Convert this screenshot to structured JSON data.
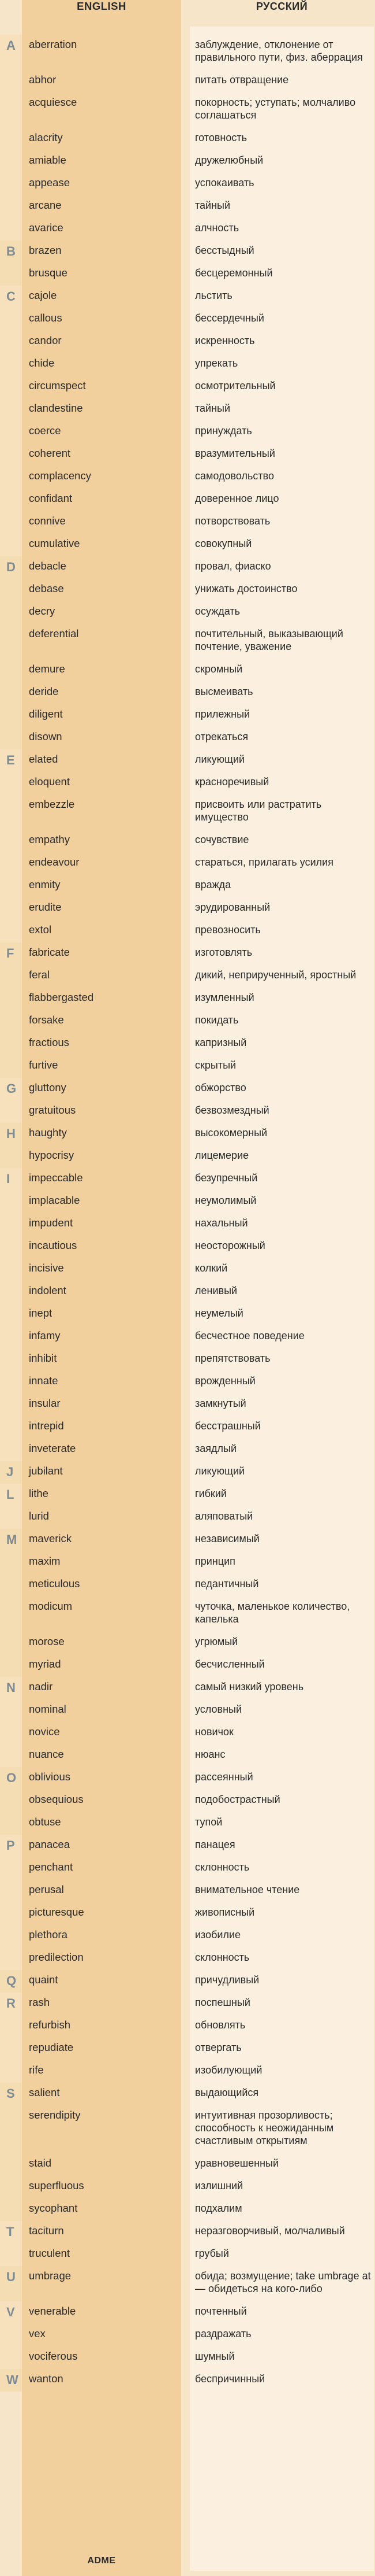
{
  "headers": {
    "english": "ENGLISH",
    "russian": "РУССКИЙ"
  },
  "footer": "ADME",
  "groups": [
    {
      "letter": "A",
      "words": [
        [
          "aberration",
          "заблуждение, отклонение от правильного пути, физ. аберрация"
        ],
        [
          "abhor",
          "питать отвращение"
        ],
        [
          "acquiesce",
          "покорность; уступать; молчаливо соглашаться"
        ],
        [
          "alacrity",
          "готовность"
        ],
        [
          "amiable",
          "дружелюбный"
        ],
        [
          "appease",
          "успокаивать"
        ],
        [
          "arcane",
          "тайный"
        ],
        [
          "avarice",
          "алчность"
        ]
      ]
    },
    {
      "letter": "B",
      "words": [
        [
          "brazen",
          "бесстыдный"
        ],
        [
          "brusque",
          "бесцеремонный"
        ]
      ]
    },
    {
      "letter": "C",
      "words": [
        [
          "cajole",
          "льстить"
        ],
        [
          "callous",
          "бессердечный"
        ],
        [
          "candor",
          "искренность"
        ],
        [
          "chide",
          "упрекать"
        ],
        [
          "circumspect",
          "осмотрительный"
        ],
        [
          "clandestine",
          "тайный"
        ],
        [
          "coerce",
          "принуждать"
        ],
        [
          "coherent",
          "вразумительный"
        ],
        [
          "complacency",
          "самодовольство"
        ],
        [
          "confidant",
          "доверенное лицо"
        ],
        [
          "connive",
          "потворствовать"
        ],
        [
          "cumulative",
          "совокупный"
        ]
      ]
    },
    {
      "letter": "D",
      "words": [
        [
          "debacle",
          "провал, фиаско"
        ],
        [
          "debase",
          "унижать достоинство"
        ],
        [
          "decry",
          "осуждать"
        ],
        [
          "deferential",
          "почтительный, выказывающий почтение, уважение"
        ],
        [
          "demure",
          "скромный"
        ],
        [
          "deride",
          "высмеивать"
        ],
        [
          "diligent",
          "прилежный"
        ],
        [
          "disown",
          "отрекаться"
        ]
      ]
    },
    {
      "letter": "E",
      "words": [
        [
          "elated",
          "ликующий"
        ],
        [
          "eloquent",
          "красноречивый"
        ],
        [
          "embezzle",
          "присвоить или растратить имущество"
        ],
        [
          "empathy",
          "сочувствие"
        ],
        [
          "endeavour",
          "стараться, прилагать усилия"
        ],
        [
          "enmity",
          "вражда"
        ],
        [
          "erudite",
          "эрудированный"
        ],
        [
          "extol",
          "превозносить"
        ]
      ]
    },
    {
      "letter": "F",
      "words": [
        [
          "fabricate",
          "изготовлять"
        ],
        [
          "feral",
          "дикий, неприрученный, яростный"
        ],
        [
          "flabbergasted",
          "изумленный"
        ],
        [
          "forsake",
          "покидать"
        ],
        [
          "fractious",
          "капризный"
        ],
        [
          "furtive",
          "скрытый"
        ]
      ]
    },
    {
      "letter": "G",
      "words": [
        [
          "gluttony",
          "обжорство"
        ],
        [
          "gratuitous",
          "безвозмездный"
        ]
      ]
    },
    {
      "letter": "H",
      "words": [
        [
          "haughty",
          "высокомерный"
        ],
        [
          "hypocrisy",
          "лицемерие"
        ]
      ]
    },
    {
      "letter": "I",
      "words": [
        [
          "impeccable",
          "безупречный"
        ],
        [
          "implacable",
          "неумолимый"
        ],
        [
          "impudent",
          "нахальный"
        ],
        [
          "incautious",
          "неосторожный"
        ],
        [
          "incisive",
          "колкий"
        ],
        [
          "indolent",
          "ленивый"
        ],
        [
          "inept",
          "неумелый"
        ],
        [
          "infamy",
          "бесчестное поведение"
        ],
        [
          "inhibit",
          "препятствовать"
        ],
        [
          "innate",
          "врожденный"
        ],
        [
          "insular",
          "замкнутый"
        ],
        [
          "intrepid",
          "бесстрашный"
        ],
        [
          "inveterate",
          "заядлый"
        ]
      ]
    },
    {
      "letter": "J",
      "words": [
        [
          "jubilant",
          "ликующий"
        ]
      ]
    },
    {
      "letter": "L",
      "words": [
        [
          "lithe",
          "гибкий"
        ],
        [
          "lurid",
          "аляповатый"
        ]
      ]
    },
    {
      "letter": "M",
      "words": [
        [
          "maverick",
          "независимый"
        ],
        [
          "maxim",
          "принцип"
        ],
        [
          "meticulous",
          "педантичный"
        ],
        [
          "modicum",
          "чуточка, маленькое количество, капелька"
        ],
        [
          "morose",
          "угрюмый"
        ],
        [
          "myriad",
          "бесчисленный"
        ]
      ]
    },
    {
      "letter": "N",
      "words": [
        [
          "nadir",
          "самый низкий уровень"
        ],
        [
          "nominal",
          "условный"
        ],
        [
          "novice",
          "новичок"
        ],
        [
          "nuance",
          "нюанс"
        ]
      ]
    },
    {
      "letter": "O",
      "words": [
        [
          "oblivious",
          "рассеянный"
        ],
        [
          "obsequious",
          "подобострастный"
        ],
        [
          "obtuse",
          "тупой"
        ]
      ]
    },
    {
      "letter": "P",
      "words": [
        [
          "panacea",
          "панацея"
        ],
        [
          "penchant",
          "склонность"
        ],
        [
          "perusal",
          "внимательное чтение"
        ],
        [
          "picturesque",
          "живописный"
        ],
        [
          "plethora",
          "изобилие"
        ],
        [
          "predilection",
          "склонность"
        ]
      ]
    },
    {
      "letter": "Q",
      "words": [
        [
          "quaint",
          "причудливый"
        ]
      ]
    },
    {
      "letter": "R",
      "words": [
        [
          "rash",
          "поспешный"
        ],
        [
          "refurbish",
          "обновлять"
        ],
        [
          "repudiate",
          "отвергать"
        ],
        [
          "rife",
          "изобилующий"
        ]
      ]
    },
    {
      "letter": "S",
      "words": [
        [
          "salient",
          "выдающийся"
        ],
        [
          "serendipity",
          "интуитивная прозорливость; способность к неожиданным счастливым открытиям"
        ],
        [
          "staid",
          "уравновешенный"
        ],
        [
          "superfluous",
          "излишний"
        ],
        [
          "sycophant",
          "подхалим"
        ]
      ]
    },
    {
      "letter": "T",
      "words": [
        [
          "taciturn",
          "неразговорчивый, молчаливый"
        ],
        [
          "truculent",
          "грубый"
        ]
      ]
    },
    {
      "letter": "U",
      "words": [
        [
          "umbrage",
          "обида; возмущение; take umbrage at — обидеться на кого-либо"
        ]
      ]
    },
    {
      "letter": "V",
      "words": [
        [
          "venerable",
          "почтенный"
        ],
        [
          "vex",
          "раздражать"
        ],
        [
          "vociferous",
          "шумный"
        ]
      ]
    },
    {
      "letter": "W",
      "words": [
        [
          "wanton",
          "беспричинный"
        ]
      ]
    }
  ]
}
